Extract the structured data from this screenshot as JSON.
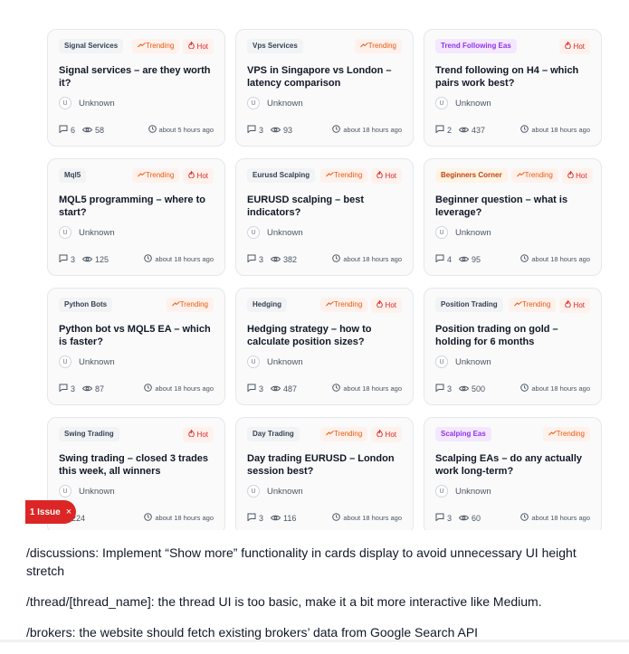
{
  "cards": [
    {
      "category": "Signal Services",
      "cat_color": "gray",
      "trending": "Trending",
      "hot": "Hot",
      "title": "Signal services – are they worth it?",
      "avatar": "U",
      "author": "Unknown",
      "replies": "6",
      "views": "58",
      "time": "about 5 hours ago"
    },
    {
      "category": "Vps Services",
      "cat_color": "gray",
      "trending": "Trending",
      "hot": "",
      "title": "VPS in Singapore vs London – latency comparison",
      "avatar": "U",
      "author": "Unknown",
      "replies": "3",
      "views": "93",
      "time": "about 18 hours ago"
    },
    {
      "category": "Trend Following Eas",
      "cat_color": "purple",
      "trending": "",
      "hot": "Hot",
      "title": "Trend following on H4 – which pairs work best?",
      "avatar": "U",
      "author": "Unknown",
      "replies": "2",
      "views": "437",
      "time": "about 18 hours ago"
    },
    {
      "category": "Mql5",
      "cat_color": "gray",
      "trending": "Trending",
      "hot": "Hot",
      "title": "MQL5 programming – where to start?",
      "avatar": "U",
      "author": "Unknown",
      "replies": "3",
      "views": "125",
      "time": "about 18 hours ago"
    },
    {
      "category": "Eurusd Scalping",
      "cat_color": "gray",
      "trending": "Trending",
      "hot": "Hot",
      "title": "EURUSD scalping – best indicators?",
      "avatar": "U",
      "author": "Unknown",
      "replies": "3",
      "views": "382",
      "time": "about 18 hours ago"
    },
    {
      "category": "Beginners Corner",
      "cat_color": "orange",
      "trending": "Trending",
      "hot": "Hot",
      "title": "Beginner question – what is leverage?",
      "avatar": "U",
      "author": "Unknown",
      "replies": "4",
      "views": "95",
      "time": "about 18 hours ago"
    },
    {
      "category": "Python Bots",
      "cat_color": "gray",
      "trending": "Trending",
      "hot": "",
      "title": "Python bot vs MQL5 EA – which is faster?",
      "avatar": "U",
      "author": "Unknown",
      "replies": "3",
      "views": "87",
      "time": "about 18 hours ago"
    },
    {
      "category": "Hedging",
      "cat_color": "gray",
      "trending": "Trending",
      "hot": "Hot",
      "title": "Hedging strategy – how to calculate position sizes?",
      "avatar": "U",
      "author": "Unknown",
      "replies": "3",
      "views": "487",
      "time": "about 18 hours ago"
    },
    {
      "category": "Position Trading",
      "cat_color": "gray",
      "trending": "Trending",
      "hot": "Hot",
      "title": "Position trading on gold – holding for 6 months",
      "avatar": "U",
      "author": "Unknown",
      "replies": "3",
      "views": "500",
      "time": "about 18 hours ago"
    },
    {
      "category": "Swing Trading",
      "cat_color": "gray",
      "trending": "",
      "hot": "Hot",
      "title": "Swing trading – closed 3 trades this week, all winners",
      "avatar": "U",
      "author": "Unknown",
      "replies": "",
      "views": "224",
      "time": "about 18 hours ago"
    },
    {
      "category": "Day Trading",
      "cat_color": "gray",
      "trending": "Trending",
      "hot": "Hot",
      "title": "Day trading EURUSD – London session best?",
      "avatar": "U",
      "author": "Unknown",
      "replies": "3",
      "views": "116",
      "time": "about 18 hours ago"
    },
    {
      "category": "Scalping Eas",
      "cat_color": "purple",
      "trending": "Trending",
      "hot": "",
      "title": "Scalping EAs – do any actually work long-term?",
      "avatar": "U",
      "author": "Unknown",
      "replies": "3",
      "views": "60",
      "time": "about 18 hours ago"
    }
  ],
  "category_colors": {
    "gray": {
      "bg": "#f1f3f5",
      "fg": "#374151"
    },
    "purple": {
      "bg": "#f3e8ff",
      "fg": "#9333ea"
    },
    "orange": {
      "bg": "#fff4e5",
      "fg": "#c2410c"
    }
  },
  "issue_badge": {
    "label": "1 Issue",
    "close": "×"
  },
  "notes": [
    "/discussions: Implement “Show more” functionality in cards display to avoid unnecessary UI height stretch",
    "/thread/[thread_name]: the thread UI is too basic, make it a bit more interactive like Medium.",
    "/brokers: the website should fetch existing brokers’ data from Google Search API"
  ]
}
